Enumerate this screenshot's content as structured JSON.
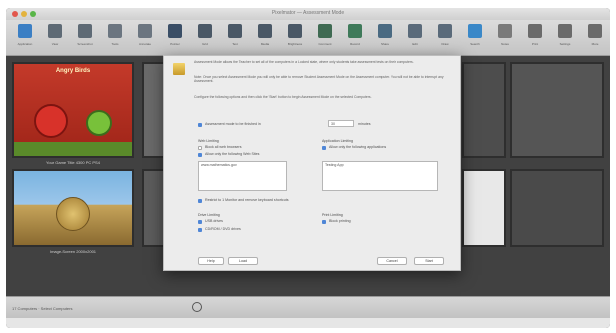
{
  "window": {
    "title": "Pixelmator — Assessment Mode"
  },
  "toolbar": {
    "items": [
      {
        "label": "Application",
        "icon": "globe-icon",
        "color": "#3b7fc4"
      },
      {
        "label": "View",
        "icon": "eye-icon",
        "color": "#5e6a75"
      },
      {
        "label": "Screenshot",
        "icon": "camera-icon",
        "color": "#5e6a75"
      },
      {
        "label": "Tools",
        "icon": "wrench-icon",
        "color": "#6b7580"
      },
      {
        "label": "Annotate",
        "icon": "pen-icon",
        "color": "#6b7580"
      },
      {
        "label": "Pointer",
        "icon": "pointer-icon",
        "color": "#3a4e66"
      },
      {
        "label": "Grid",
        "icon": "grid-icon",
        "color": "#4a5866"
      },
      {
        "label": "Text",
        "icon": "text-icon",
        "color": "#4a5866"
      },
      {
        "label": "Media",
        "icon": "media-icon",
        "color": "#4a5866"
      },
      {
        "label": "Brightness",
        "icon": "brightness-icon",
        "color": "#4a5866"
      },
      {
        "label": "Comment",
        "icon": "comment-icon",
        "color": "#3f6a52"
      },
      {
        "label": "Record",
        "icon": "record-icon",
        "color": "#3f7a5a"
      },
      {
        "label": "Share",
        "icon": "share-icon",
        "color": "#4a6a82"
      },
      {
        "label": "Edit",
        "icon": "edit-icon",
        "color": "#5a6a7a"
      },
      {
        "label": "Draw",
        "icon": "draw-icon",
        "color": "#5a6a7a"
      },
      {
        "label": "Search",
        "icon": "search-icon",
        "color": "#3a88c8"
      },
      {
        "label": "Notes",
        "icon": "notes-icon",
        "color": "#7a7a7a"
      },
      {
        "label": "Print",
        "icon": "print-icon",
        "color": "#6a6a6a"
      },
      {
        "label": "Settings",
        "icon": "settings-icon",
        "color": "#6a6a6a"
      },
      {
        "label": "More",
        "icon": "more-icon",
        "color": "#6a6a6a"
      }
    ]
  },
  "thumbnails": {
    "angry_birds_title": "Angry Birds",
    "angry_birds_caption": "Your Game Title 4300 PC PS4",
    "hay_caption": "Image-Screen 2000x2001"
  },
  "dialog": {
    "p1": "Assessment Mode allows the Teacher to set all of the computers in a Locked state, where only students take assessment tests on their computers.",
    "p2": "Note: Once you select Assessment Mode you will only be able to remove Student Assessment Mode on the Assessment computer. You will not be able to interrupt any Assessment.",
    "p3": "Configure the following options and then click the 'Start' button to begin Assessment Mode on the selected Computers.",
    "duration_label": "Assessment mode to be finished in",
    "duration_value": "30",
    "duration_unit": "minutes",
    "web_limiting": "Web Limiting",
    "block_internet": "Block all web browsers",
    "allow_browsing": "Allow only the following Web Sites",
    "websites_value": "www.mathematics.gov",
    "app_limiting": "Application Limiting",
    "allow_apps": "Allow only the following applications",
    "apps_value": "Testing App",
    "restrict_note": "Restrict to 1 Monitor and remove keyboard shortcuts",
    "drive_limiting": "Drive Limiting",
    "usb_drives": "USB drives",
    "cd_drives": "CD/ROM / DVD drives",
    "print_limiting": "Print Limiting",
    "block_printing": "Block printing",
    "btn_help": "Help",
    "btn_load": "Load",
    "btn_cancel": "Cancel",
    "btn_start": "Start"
  },
  "statusbar": {
    "text": "17 Computers · Select Computers"
  },
  "colors": {
    "checkbox_on": "#4f86d6",
    "window_bg": "#3b3b3b"
  }
}
